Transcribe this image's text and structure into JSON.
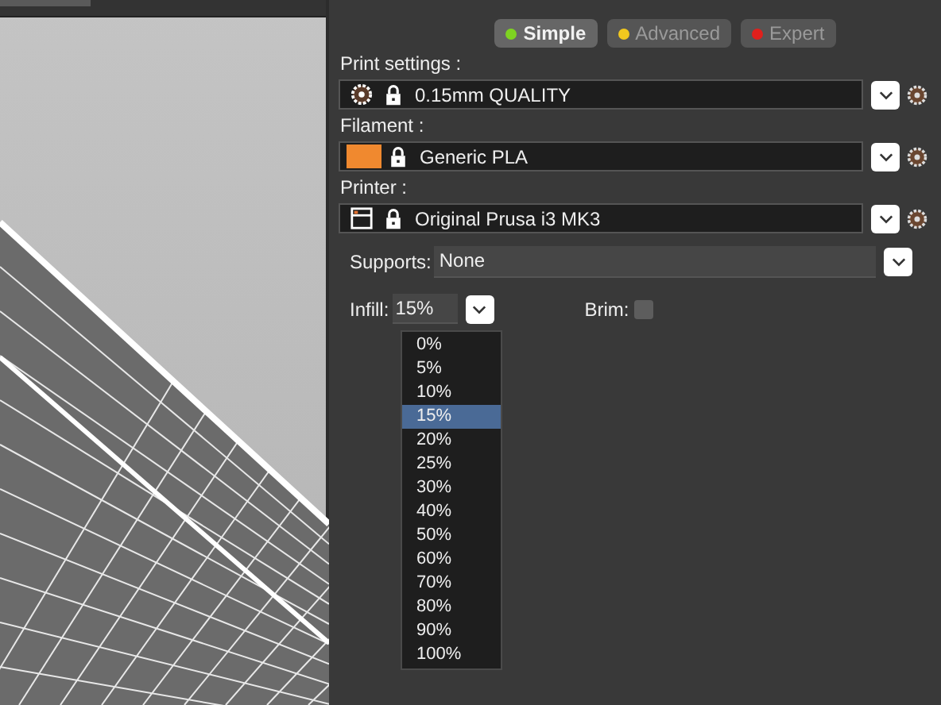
{
  "modes": [
    {
      "label": "Simple",
      "selected": true,
      "color": "#7ed321"
    },
    {
      "label": "Advanced",
      "selected": false,
      "color": "#f2c81e"
    },
    {
      "label": "Expert",
      "selected": false,
      "color": "#e0201c"
    }
  ],
  "presets": [
    {
      "label": "Print settings :",
      "value": "0.15mm QUALITY",
      "kind": "print"
    },
    {
      "label": "Filament :",
      "value": "Generic PLA",
      "kind": "filament",
      "color": "#f0892f"
    },
    {
      "label": "Printer :",
      "value": "Original Prusa i3 MK3",
      "kind": "printer"
    }
  ],
  "supports": {
    "label": "Supports:",
    "value": "None"
  },
  "infill": {
    "label": "Infill:",
    "value": "15%",
    "expanded": true,
    "options": [
      {
        "label": "0%",
        "selected": false
      },
      {
        "label": "5%",
        "selected": false
      },
      {
        "label": "10%",
        "selected": false
      },
      {
        "label": "15%",
        "selected": true
      },
      {
        "label": "20%",
        "selected": false
      },
      {
        "label": "25%",
        "selected": false
      },
      {
        "label": "30%",
        "selected": false
      },
      {
        "label": "40%",
        "selected": false
      },
      {
        "label": "50%",
        "selected": false
      },
      {
        "label": "60%",
        "selected": false
      },
      {
        "label": "70%",
        "selected": false
      },
      {
        "label": "80%",
        "selected": false
      },
      {
        "label": "90%",
        "selected": false
      },
      {
        "label": "100%",
        "selected": false
      }
    ]
  },
  "brim": {
    "label": "Brim:",
    "checked": false
  }
}
